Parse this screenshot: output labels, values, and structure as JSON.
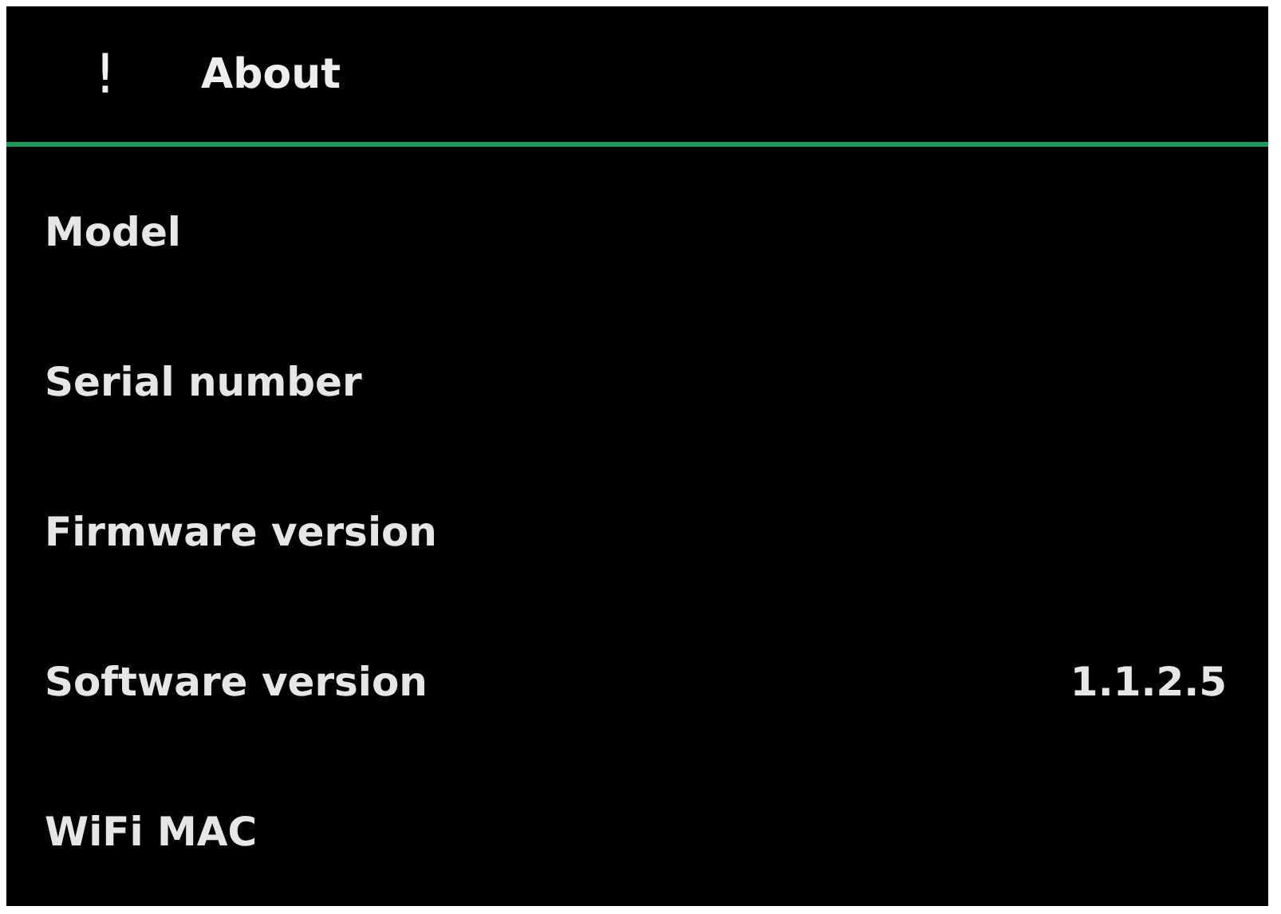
{
  "header": {
    "icon": "!",
    "title": "About"
  },
  "rows": [
    {
      "label": "Model"
    },
    {
      "label": "Serial number"
    },
    {
      "label": "Firmware version"
    },
    {
      "label": "Software version",
      "value": "1.1.2.5"
    },
    {
      "label": "WiFi MAC"
    }
  ]
}
